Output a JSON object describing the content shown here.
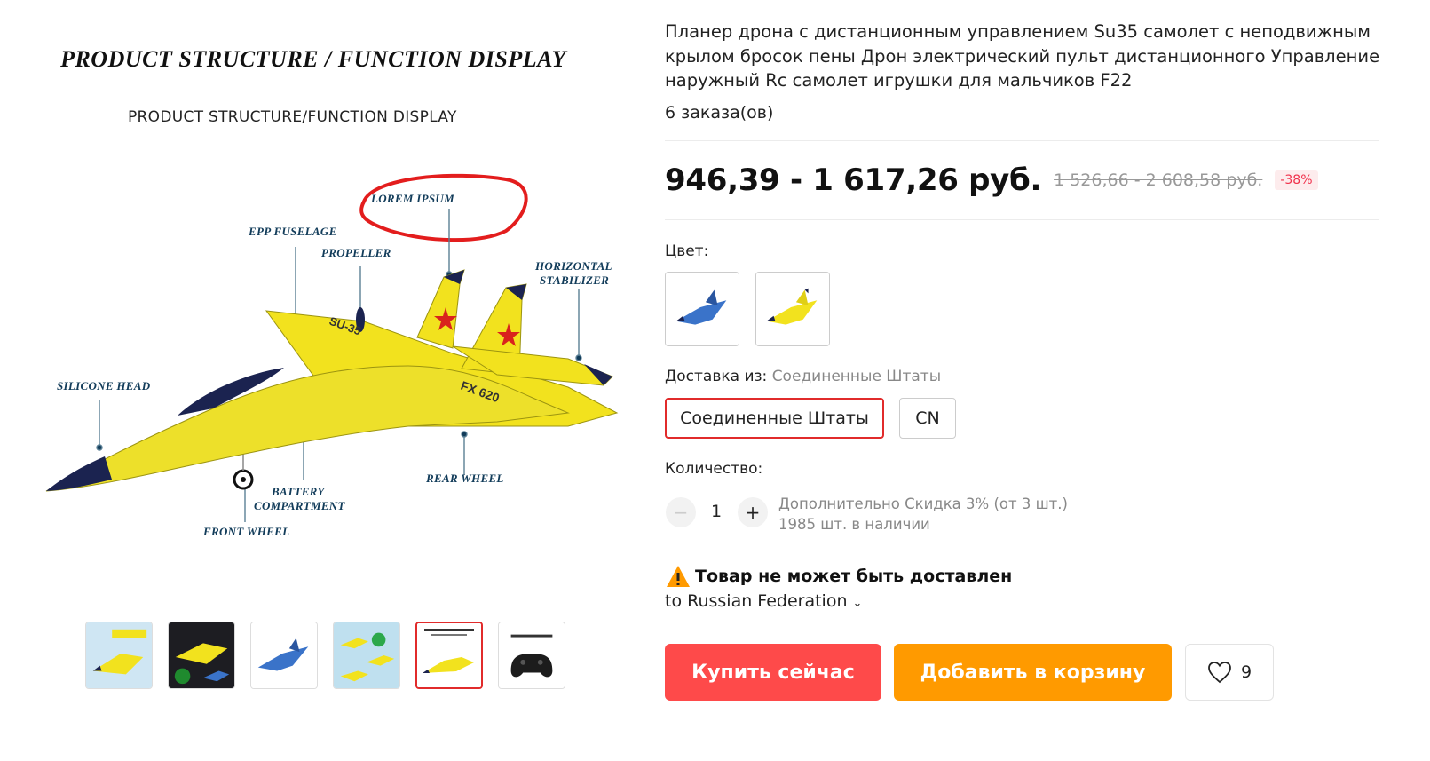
{
  "gallery": {
    "main_image": {
      "title": "PRODUCT STRUCTURE / FUNCTION DISPLAY",
      "subtitle": "PRODUCT STRUCTURE/FUNCTION DISPLAY",
      "callouts": {
        "lorem_ipsum": "LOREM IPSUM",
        "epp_fuselage": "EPP FUSELAGE",
        "propeller": "PROPELLER",
        "horizontal_stabilizer_1": "HORIZONTAL",
        "horizontal_stabilizer_2": "STABILIZER",
        "silicone_head": "SILICONE HEAD",
        "battery_1": "BATTERY",
        "battery_2": "COMPARTMENT",
        "rear_wheel": "REAR WHEEL",
        "front_wheel": "FRONT WHEEL"
      },
      "plane_markings": {
        "su35": "SU-35",
        "fx620": "FX 620"
      }
    },
    "thumbnails": [
      {
        "name": "thumb-yellow-plane-box",
        "active": false
      },
      {
        "name": "thumb-night-flight",
        "active": false
      },
      {
        "name": "thumb-blue-plane",
        "active": false
      },
      {
        "name": "thumb-features",
        "active": false
      },
      {
        "name": "thumb-structure",
        "active": true
      },
      {
        "name": "thumb-remote-control",
        "active": false
      }
    ]
  },
  "product": {
    "title": "Планер дрона с дистанционным управлением Su35 самолет с неподвижным крылом бросок пены Дрон электрический пульт дистанционного Управление наружный Rc самолет игрушки для мальчиков F22",
    "orders": "6 заказа(ов)",
    "price": "946,39 - 1 617,26 руб.",
    "old_price": "1 526,66 - 2 608,58 руб.",
    "discount": "-38%",
    "color_label": "Цвет:",
    "colors": [
      "blue",
      "yellow"
    ],
    "ship_from_label": "Доставка из:",
    "ship_from_value": "Соединенные Штаты",
    "ship_options": [
      "Соединенные Штаты",
      "CN"
    ],
    "quantity_label": "Количество:",
    "quantity": "1",
    "qty_minus": "−",
    "qty_plus": "+",
    "extra_discount": "Дополнительно Скидка 3% (от 3 шт.)",
    "stock": "1985 шт. в наличии",
    "warning": "Товар не может быть доставлен",
    "to_region": "to Russian Federation",
    "buy_now": "Купить сейчас",
    "add_to_cart": "Добавить в корзину",
    "wishlist_count": "9"
  },
  "colors": {
    "buy": "#fe4a4a",
    "cart": "#ff9a00",
    "accent_red": "#e12b2b",
    "plane_yellow": "#f2e21e",
    "plane_navy": "#1b2350",
    "callout_text": "#123c5a"
  }
}
